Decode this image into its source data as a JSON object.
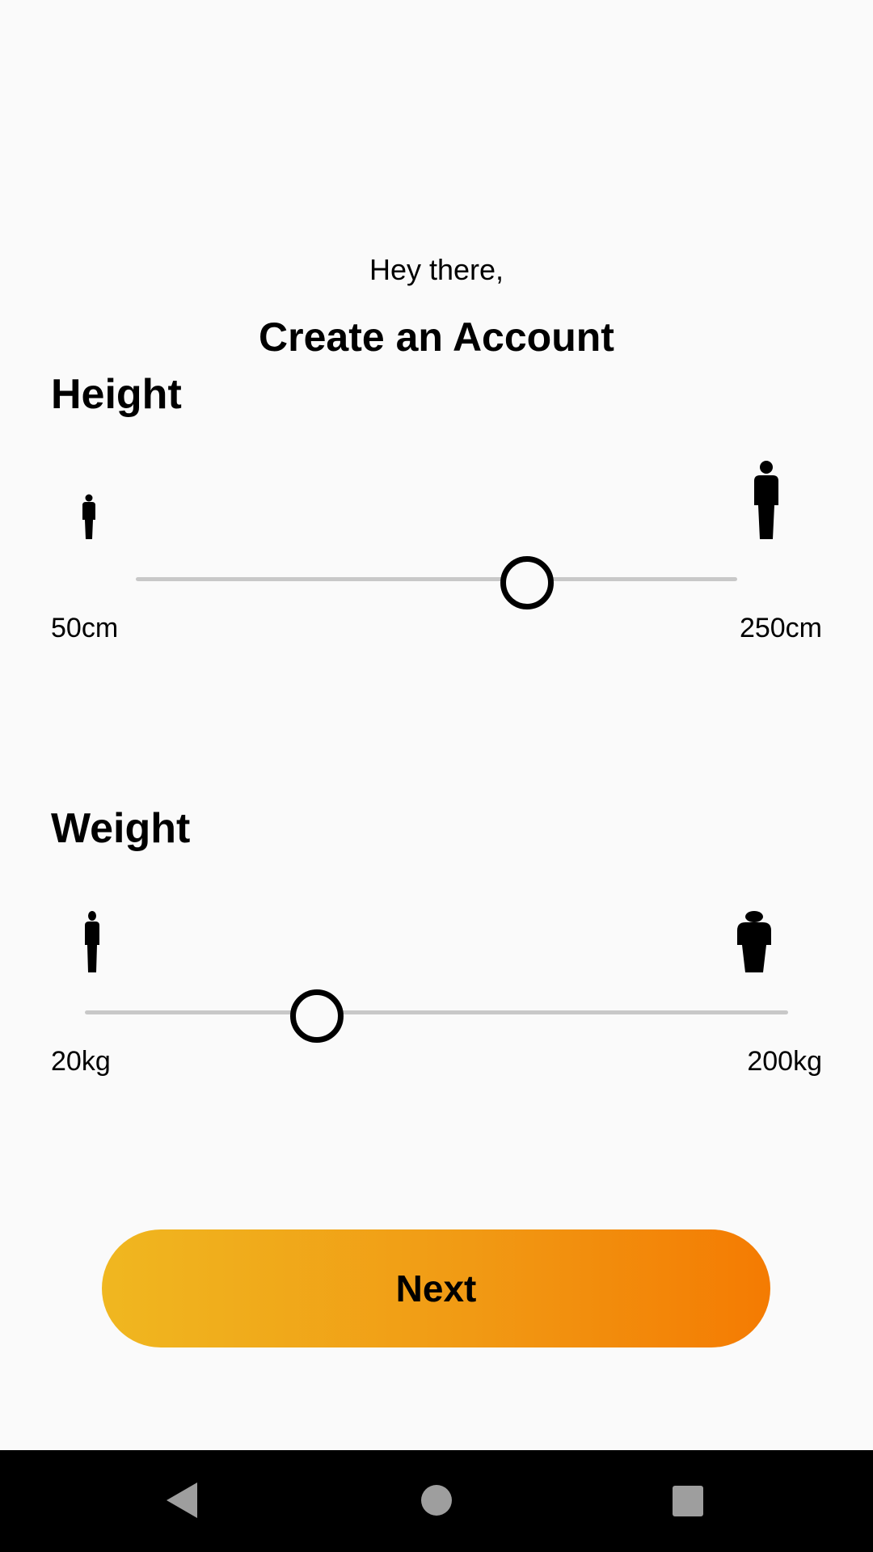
{
  "header": {
    "greeting": "Hey there,",
    "title": "Create an Account"
  },
  "height": {
    "label": "Height",
    "min_label": "50cm",
    "max_label": "250cm",
    "min": 50,
    "max": 250,
    "value_fraction": 0.65,
    "small_icon": "short-person-icon",
    "large_icon": "tall-person-icon"
  },
  "weight": {
    "label": "Weight",
    "min_label": "20kg",
    "max_label": "200kg",
    "min": 20,
    "max": 200,
    "value_fraction": 0.33,
    "small_icon": "thin-person-icon",
    "large_icon": "heavy-person-icon"
  },
  "next_button": {
    "label": "Next"
  },
  "colors": {
    "gradient_start": "#f0b720",
    "gradient_end": "#f47b02",
    "track": "#c8c8c8"
  },
  "navbar": {
    "icons": [
      "back-icon",
      "home-icon",
      "recents-icon"
    ]
  }
}
